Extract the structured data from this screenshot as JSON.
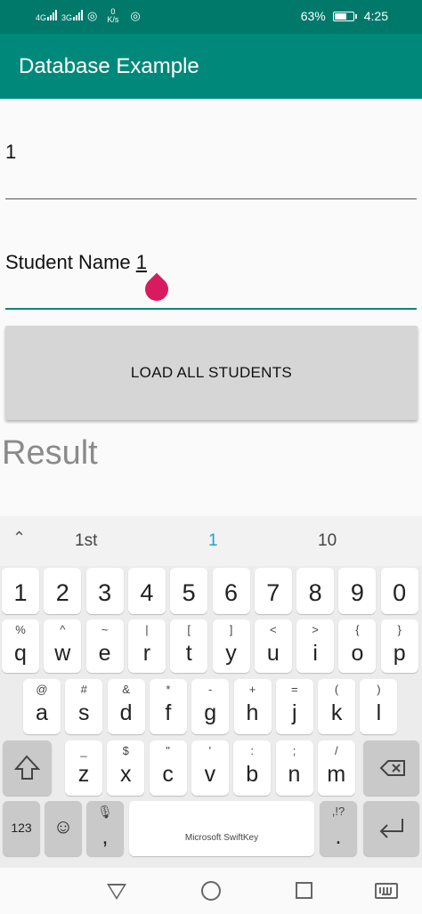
{
  "status": {
    "net1": "4G",
    "net2": "3G",
    "speed_value": "0",
    "speed_unit": "K/s",
    "battery": "63%",
    "time": "4:25"
  },
  "app": {
    "title": "Database Example"
  },
  "form": {
    "id_value": "1",
    "name_value": "Student Name ",
    "name_cursor_char": "1"
  },
  "button": {
    "label": "LOAD ALL STUDENTS"
  },
  "result": {
    "label": "Result"
  },
  "keyboard": {
    "suggestions": [
      "1st",
      "1",
      "10"
    ],
    "number_row": [
      "1",
      "2",
      "3",
      "4",
      "5",
      "6",
      "7",
      "8",
      "9",
      "0"
    ],
    "row1": [
      {
        "alt": "%",
        "key": "q"
      },
      {
        "alt": "^",
        "key": "w"
      },
      {
        "alt": "~",
        "key": "e"
      },
      {
        "alt": "|",
        "key": "r"
      },
      {
        "alt": "[",
        "key": "t"
      },
      {
        "alt": "]",
        "key": "y"
      },
      {
        "alt": "<",
        "key": "u"
      },
      {
        "alt": ">",
        "key": "i"
      },
      {
        "alt": "{",
        "key": "o"
      },
      {
        "alt": "}",
        "key": "p"
      }
    ],
    "row2": [
      {
        "alt": "@",
        "key": "a"
      },
      {
        "alt": "#",
        "key": "s"
      },
      {
        "alt": "&",
        "key": "d"
      },
      {
        "alt": "*",
        "key": "f"
      },
      {
        "alt": "-",
        "key": "g"
      },
      {
        "alt": "+",
        "key": "h"
      },
      {
        "alt": "=",
        "key": "j"
      },
      {
        "alt": "(",
        "key": "k"
      },
      {
        "alt": ")",
        "key": "l"
      }
    ],
    "row3": [
      {
        "alt": "_",
        "key": "z"
      },
      {
        "alt": "$",
        "key": "x"
      },
      {
        "alt": "\"",
        "key": "c"
      },
      {
        "alt": "'",
        "key": "v"
      },
      {
        "alt": ":",
        "key": "b"
      },
      {
        "alt": ";",
        "key": "n"
      },
      {
        "alt": "/",
        "key": "m"
      }
    ],
    "symbols_key": "123",
    "comma": ",",
    "period": ".",
    "period_alt": ",!?",
    "space_label": "Microsoft SwiftKey"
  }
}
